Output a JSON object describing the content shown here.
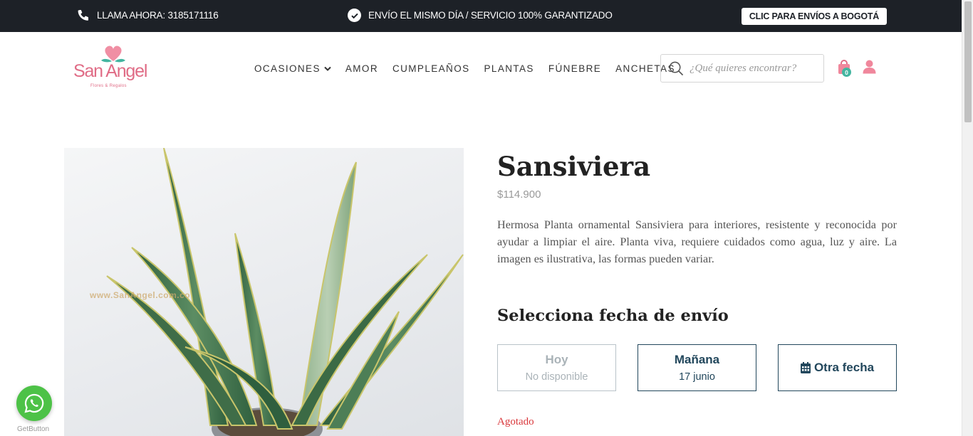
{
  "topbar": {
    "call_text": "LLAMA AHORA: 3185171116",
    "promo_text": "ENVÍO EL MISMO DÍA / SERVICIO 100% GARANTIZADO",
    "bogota_button": "CLIC PARA ENVÍOS A BOGOTÁ"
  },
  "logo": {
    "name": "San Angel",
    "tagline": "Flores & Regalos"
  },
  "nav": {
    "items": [
      "OCASIONES",
      "AMOR",
      "CUMPLEAÑOS",
      "PLANTAS",
      "FÚNEBRE",
      "ANCHETAS"
    ]
  },
  "search": {
    "placeholder": "¿Qué quieres encontrar?"
  },
  "cart": {
    "count": "0"
  },
  "product": {
    "image_watermark": "www.SanAngel.com.co",
    "title": "Sansiviera",
    "price": "$114.900",
    "description": "Hermosa Planta ornamental Sansiviera para interiores, resistente y reconocida por ayudar a limpiar el aire. Planta viva, requiere cuidados como agua, luz y aire. La imagen es ilustrativa, las formas pueden variar.",
    "shipping_heading": "Selecciona fecha de envío",
    "dates": [
      {
        "label": "Hoy",
        "sub": "No disponible"
      },
      {
        "label": "Mañana",
        "sub": "17 junio"
      },
      {
        "label": "Otra fecha"
      }
    ],
    "stock_status": "Agotado"
  },
  "whatsapp": {
    "label": "GetButton"
  },
  "colors": {
    "topbar_bg": "#1d2127",
    "brand_pink": "#e06c86",
    "accent_teal": "#43b5a0",
    "date_border": "#22475c",
    "soldout_red": "#d9373b",
    "whatsapp_green": "#4dc247"
  }
}
